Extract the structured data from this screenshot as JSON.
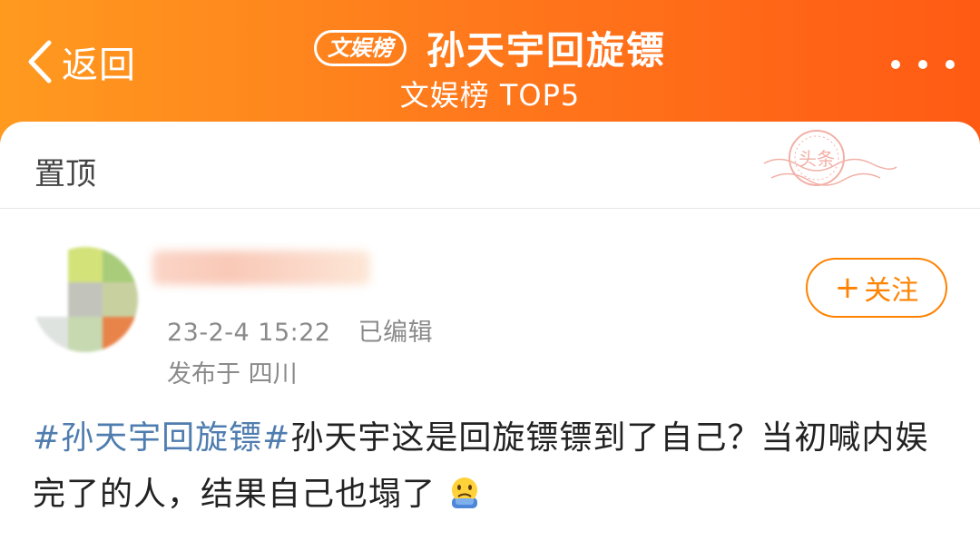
{
  "header": {
    "back_label": "返回",
    "badge_label": "文娱榜",
    "topic_title": "孙天宇回旋镖",
    "subtitle": "文娱榜 TOP5",
    "more_icon": "more-dots-icon"
  },
  "pinned": {
    "label": "置顶",
    "stamp_text": "头条"
  },
  "post": {
    "timestamp": "23-2-4 15:22",
    "edited_label": "已编辑",
    "location": "发布于 四川",
    "follow_label": "关注",
    "follow_icon": "plus-icon",
    "hashtag": "#孙天宇回旋镖#",
    "body": "孙天宇这是回旋镖镖到了自己？当初喊内娱完了的人，结果自己也塌了",
    "emoji": "worried-face-emoji"
  },
  "colors": {
    "header_start": "#ff9a1f",
    "header_end": "#ff5a14",
    "accent": "#ff8200",
    "hashtag": "#507daf",
    "meta_text": "#8a8a8a"
  }
}
